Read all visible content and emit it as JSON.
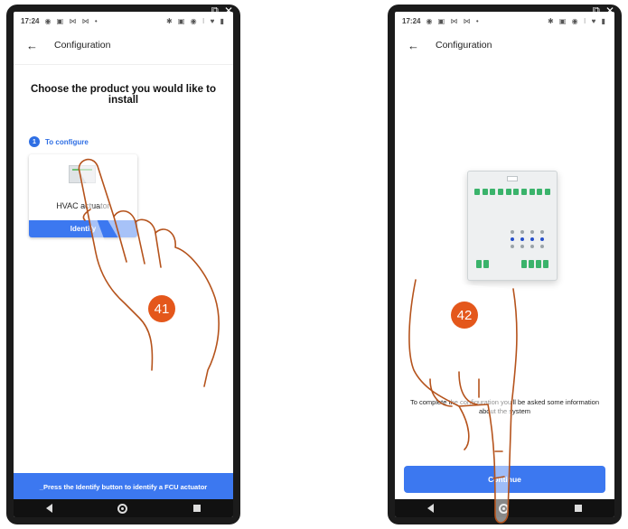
{
  "screens": [
    {
      "status": {
        "time": "17:24",
        "left_icons": "◉ ▣ ⋈ ⋈ •",
        "right_icons": "✱ ▣ ◉ ⁝ ♥ ▮"
      },
      "appbar": {
        "back_icon": "arrow-left-icon",
        "title": "Configuration"
      },
      "heading": "Choose the product you would like to install",
      "section": {
        "number": "1",
        "label": "To configure"
      },
      "product_card": {
        "name": "HVAC actuator",
        "button_label": "Identify"
      },
      "banner": "_Press the Identify button to identify a FCU actuator",
      "step_badge": "41"
    },
    {
      "status": {
        "time": "17:24",
        "left_icons": "◉ ▣ ⋈ ⋈ •",
        "right_icons": "✱ ▣ ◉ ⁝ ♥ ▮"
      },
      "appbar": {
        "back_icon": "arrow-left-icon",
        "title": "Configuration"
      },
      "body_text": "To complete the configuration you'll be asked some information about the system",
      "continue_label": "Continue",
      "step_badge": "42"
    }
  ],
  "colors": {
    "accent": "#3c78f0",
    "badge": "#e4571b",
    "hand_outline": "#b5531c"
  }
}
